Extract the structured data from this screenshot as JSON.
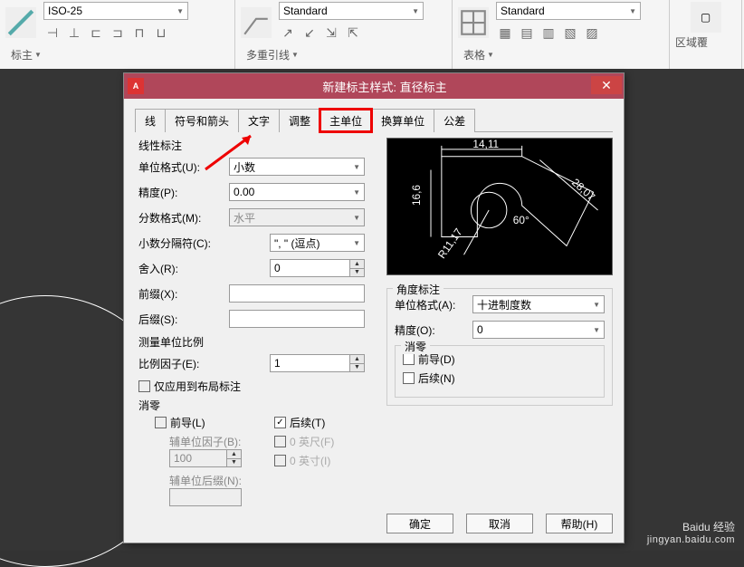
{
  "ribbon": {
    "dim_style": "ISO-25",
    "dim_label": "标主",
    "ml_style": "Standard",
    "ml_label": "多重引线",
    "table_style": "Standard",
    "table_label": "表格",
    "region_label": "区域覆"
  },
  "dialog": {
    "title": "新建标主样式: 直径标主",
    "tabs": [
      "线",
      "符号和箭头",
      "文字",
      "调整",
      "主单位",
      "换算单位",
      "公差"
    ],
    "linear_group": "线性标注",
    "unit_format_label": "单位格式(U):",
    "unit_format_value": "小数",
    "precision_label": "精度(P):",
    "precision_value": "0.00",
    "fraction_label": "分数格式(M):",
    "fraction_value": "水平",
    "decimal_sep_label": "小数分隔符(C):",
    "decimal_sep_value": "\", \" (逗点)",
    "round_label": "舍入(R):",
    "round_value": "0",
    "prefix_label": "前缀(X):",
    "prefix_value": "",
    "suffix_label": "后缀(S):",
    "suffix_value": "",
    "measure_group": "测量单位比例",
    "scale_factor_label": "比例因子(E):",
    "scale_factor_value": "1",
    "layout_only_label": "仅应用到布局标注",
    "zero_group": "消零",
    "leading_label": "前导(L)",
    "trailing_label": "后续(T)",
    "subunit_factor_label": "辅单位因子(B):",
    "subunit_factor_value": "100",
    "subunit_suffix_label": "辅单位后缀(N):",
    "subunit_suffix_value": "",
    "zero_feet_label": "0 英尺(F)",
    "zero_inch_label": "0 英寸(I)",
    "angle_group": "角度标注",
    "angle_unit_label": "单位格式(A):",
    "angle_unit_value": "十进制度数",
    "angle_precision_label": "精度(O):",
    "angle_precision_value": "0",
    "angle_zero_group": "消零",
    "angle_leading_label": "前导(D)",
    "angle_trailing_label": "后续(N)",
    "ok": "确定",
    "cancel": "取消",
    "help": "帮助(H)",
    "preview_dims": {
      "top": "14,11",
      "right": "28,07",
      "angle": "60°",
      "radius": "R11,17",
      "left": "16,6"
    }
  },
  "watermark": {
    "brand": "Baidu 经验",
    "url": "jingyan.baidu.com"
  }
}
